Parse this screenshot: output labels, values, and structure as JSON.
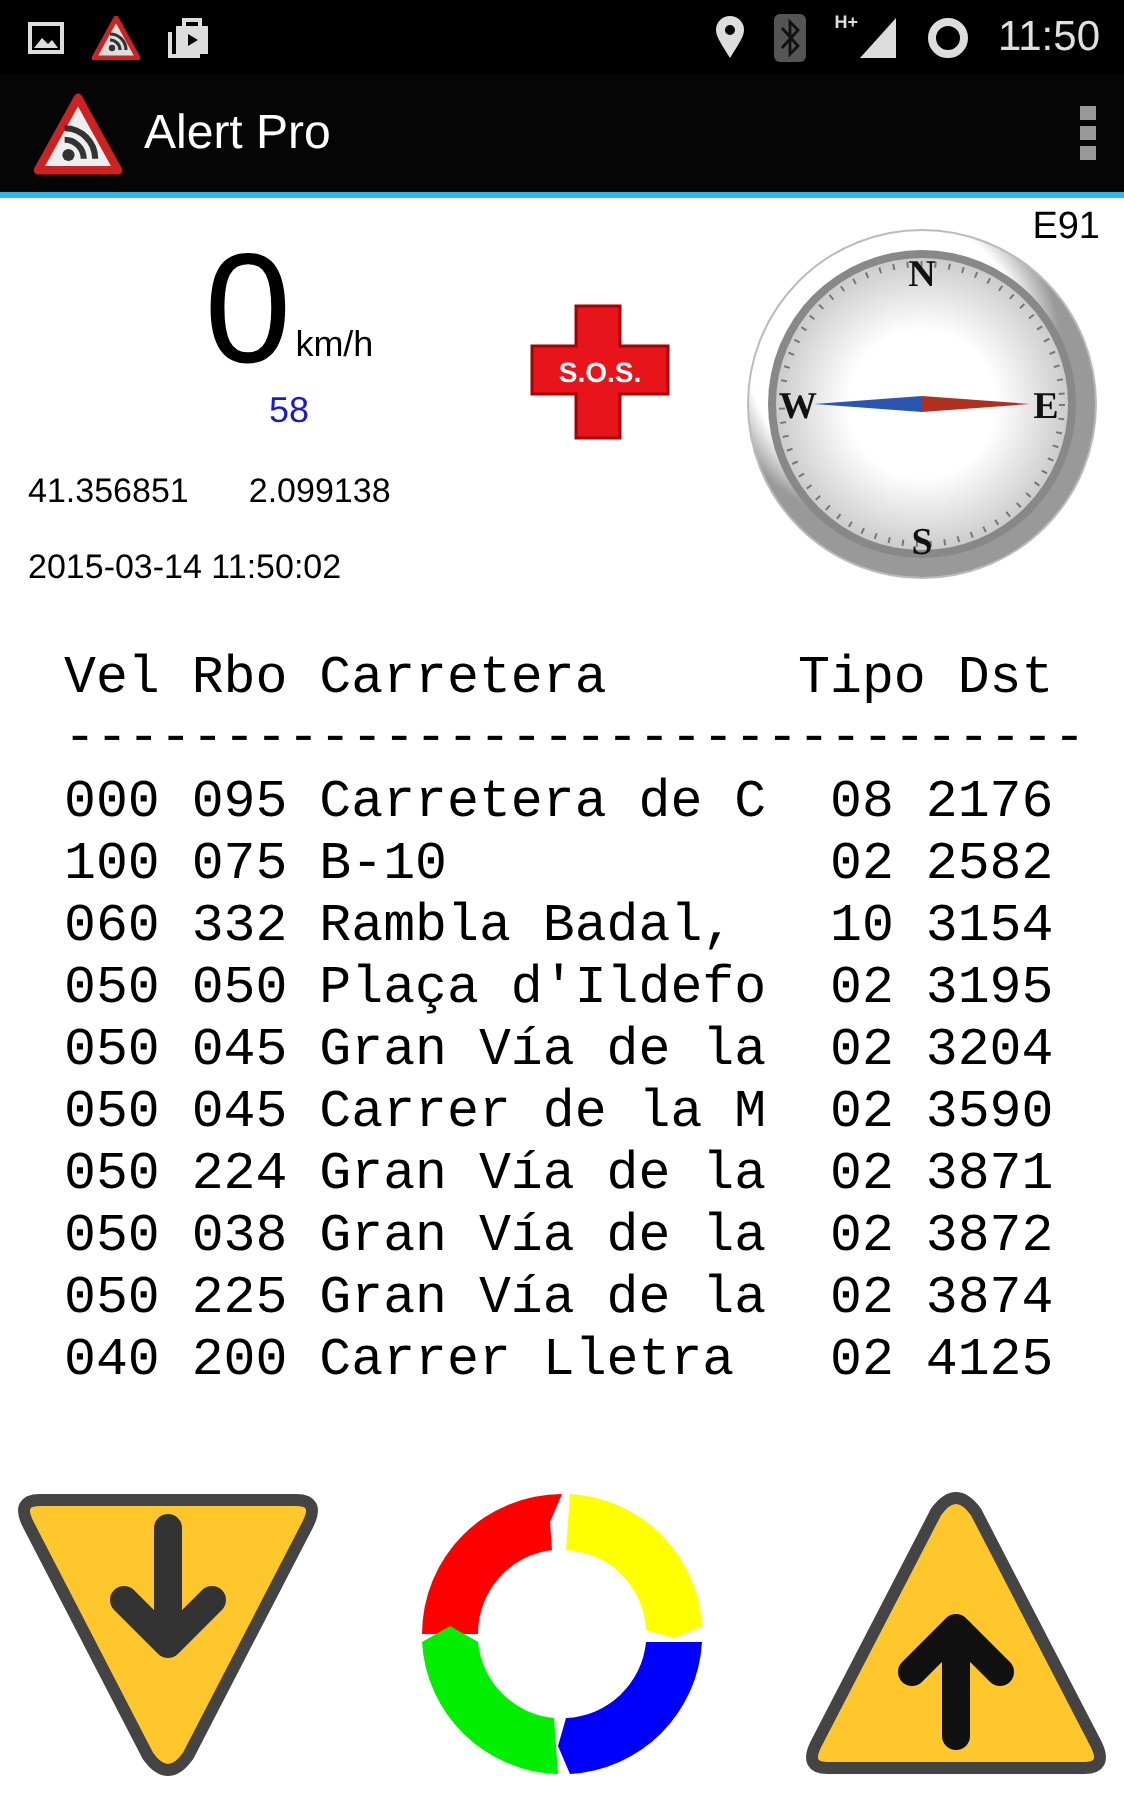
{
  "status_bar": {
    "network": "H+",
    "time": "11:50"
  },
  "app_bar": {
    "title": "Alert Pro"
  },
  "speed": {
    "value": "0",
    "unit": "km/h",
    "limit": "58"
  },
  "position": {
    "latitude": "41.356851",
    "longitude": "2.099138",
    "timestamp": "2015-03-14 11:50:02"
  },
  "sos": {
    "label": "S.O.S."
  },
  "compass": {
    "road": "E91",
    "letters": [
      "N",
      "E",
      "S",
      "W"
    ]
  },
  "table": {
    "columns": [
      "Vel",
      "Rbo",
      "Carretera",
      "Tipo",
      "Dst"
    ],
    "separator": "--------------------------------",
    "rows": [
      [
        "000",
        "095",
        "Carretera de C",
        "08",
        "2176"
      ],
      [
        "100",
        "075",
        "B-10",
        "02",
        "2582"
      ],
      [
        "060",
        "332",
        "Rambla Badal,",
        "10",
        "3154"
      ],
      [
        "050",
        "050",
        "Plaça d'Ildefo",
        "02",
        "3195"
      ],
      [
        "050",
        "045",
        "Gran Vía de la",
        "02",
        "3204"
      ],
      [
        "050",
        "045",
        "Carrer de la M",
        "02",
        "3590"
      ],
      [
        "050",
        "224",
        "Gran Vía de la",
        "02",
        "3871"
      ],
      [
        "050",
        "038",
        "Gran Vía de la",
        "02",
        "3872"
      ],
      [
        "050",
        "225",
        "Gran Vía de la",
        "02",
        "3874"
      ],
      [
        "040",
        "200",
        "Carrer Lletra",
        "02",
        "4125"
      ]
    ]
  }
}
